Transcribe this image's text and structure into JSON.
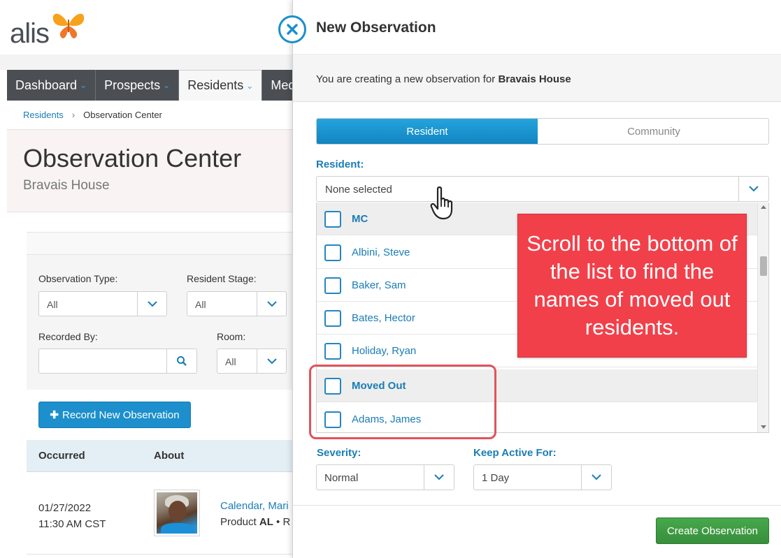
{
  "app": {
    "logo_text": "alis"
  },
  "nav": {
    "tabs": [
      {
        "label": "Dashboard",
        "active": false,
        "chevron": true
      },
      {
        "label": "Prospects",
        "active": false,
        "chevron": true
      },
      {
        "label": "Residents",
        "active": true,
        "chevron": true
      },
      {
        "label": "Med",
        "active": false,
        "chevron": false
      }
    ]
  },
  "breadcrumb": {
    "link": "Residents",
    "separator": "›",
    "current": "Observation Center"
  },
  "page": {
    "title": "Observation Center",
    "subtitle": "Bravais House"
  },
  "filters": {
    "observation_type": {
      "label": "Observation Type:",
      "value": "All"
    },
    "resident_stage": {
      "label": "Resident Stage:",
      "value": "All"
    },
    "recorded_by": {
      "label": "Recorded By:",
      "value": ""
    },
    "room": {
      "label": "Room:",
      "value": "All"
    }
  },
  "record_button": {
    "label": "Record New Observation"
  },
  "table": {
    "headers": {
      "occurred": "Occurred",
      "about": "About"
    },
    "rows": [
      {
        "date": "01/27/2022",
        "time": "11:30 AM CST",
        "name": "Calendar, Mari",
        "product_prefix": "Product",
        "product_code": "AL",
        "product_suffix": " • R"
      }
    ]
  },
  "modal": {
    "title": "New Observation",
    "info_prefix": "You are creating a new observation for ",
    "info_community": "Bravais House",
    "tabs": {
      "resident": "Resident",
      "community": "Community"
    },
    "resident_label": "Resident:",
    "resident_select_value": "None selected",
    "list_items": [
      {
        "label": "MC",
        "group": true
      },
      {
        "label": "Albini, Steve",
        "group": false
      },
      {
        "label": "Baker, Sam",
        "group": false
      },
      {
        "label": "Bates, Hector",
        "group": false
      },
      {
        "label": "Holiday, Ryan",
        "group": false
      },
      {
        "label": "Moved Out",
        "group": true
      },
      {
        "label": "Adams, James",
        "group": false
      }
    ],
    "severity": {
      "label": "Severity:",
      "value": "Normal"
    },
    "keep_active": {
      "label": "Keep Active For:",
      "value": "1 Day"
    },
    "create_button": "Create Observation"
  },
  "callout": {
    "text": "Scroll to the bottom of the list to find the names of moved out residents."
  },
  "colors": {
    "accent": "#1a8fcb",
    "callout": "#f2404a",
    "create": "#43a047",
    "logo_orange": "#f7a21b"
  },
  "icons": [
    "butterfly-logo-icon",
    "chevron-down-icon",
    "search-icon",
    "plus-icon",
    "close-icon",
    "hand-pointer-icon"
  ]
}
